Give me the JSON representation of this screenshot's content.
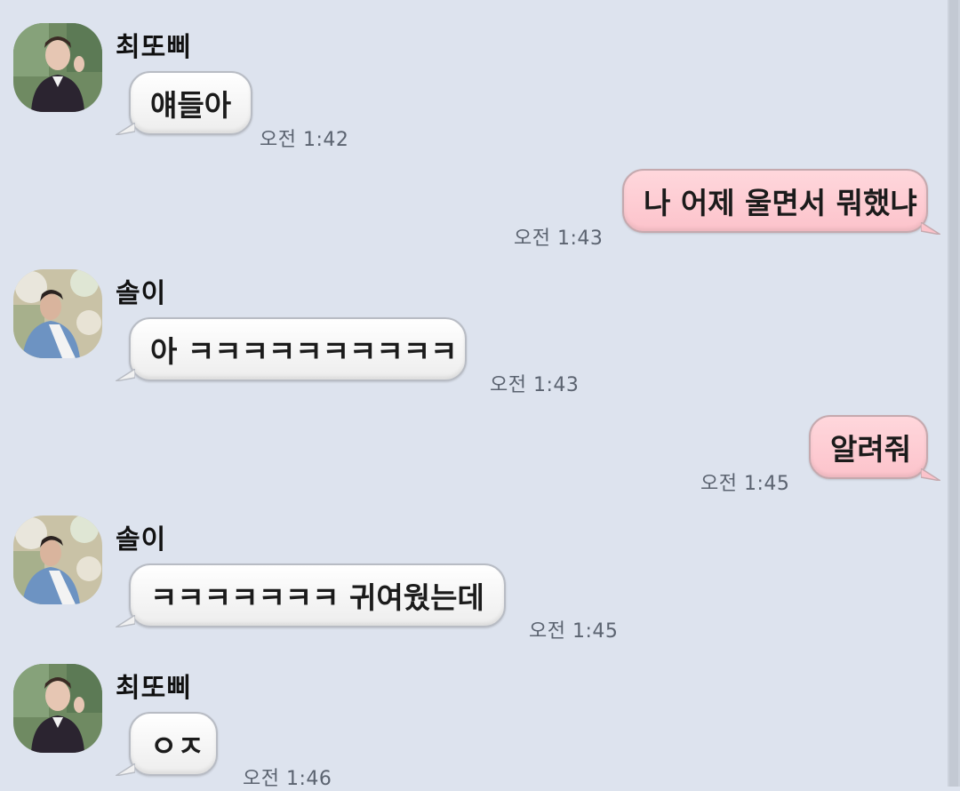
{
  "chat": {
    "messages": [
      {
        "sender": "최또삐",
        "text": "얘들아",
        "time": "오전 1:42"
      },
      {
        "text": "나 어제 울면서 뭐했냐",
        "time": "오전 1:43"
      },
      {
        "sender": "솔이",
        "text": "아 ㅋㅋㅋㅋㅋㅋㅋㅋㅋㅋ",
        "time": "오전 1:43"
      },
      {
        "text": "알려줘",
        "time": "오전 1:45"
      },
      {
        "sender": "솔이",
        "text": "ㅋㅋㅋㅋㅋㅋㅋ 귀여웠는데",
        "time": "오전 1:45"
      },
      {
        "sender": "최또삐",
        "text": "ㅇㅈ",
        "time": "오전 1:46"
      }
    ]
  },
  "colors": {
    "background": "#dde3ee",
    "incoming_bubble": "#ffffff",
    "outgoing_bubble": "#fcc8cf",
    "timestamp": "#5b6370"
  }
}
